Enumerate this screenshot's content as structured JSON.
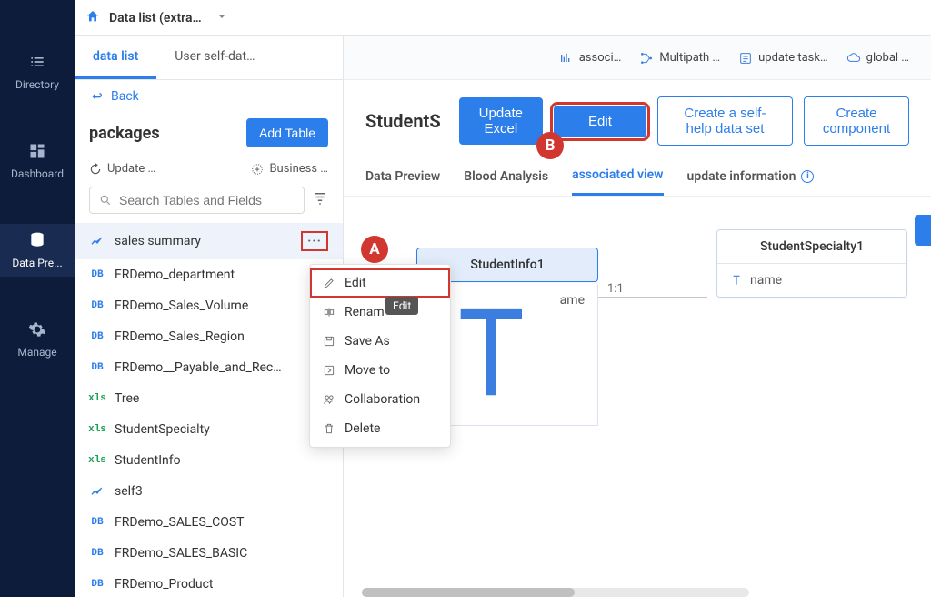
{
  "nav": {
    "items": [
      {
        "label": "Directory"
      },
      {
        "label": "Dashboard"
      },
      {
        "label": "Data Pre..."
      },
      {
        "label": "Manage"
      }
    ]
  },
  "topbar": {
    "title": "Data list (extra…"
  },
  "side": {
    "tabs": {
      "datalist": "data list",
      "selfdata": "User self-dat…"
    },
    "back": "Back",
    "packages_heading": "packages",
    "add_table": "Add Table",
    "update": "Update …",
    "business": "Business …",
    "search_placeholder": "Search Tables and Fields",
    "items": [
      {
        "icon": "chart",
        "label": "sales summary",
        "more": true
      },
      {
        "icon": "db",
        "label": "FRDemo_department"
      },
      {
        "icon": "db",
        "label": "FRDemo_Sales_Volume"
      },
      {
        "icon": "db",
        "label": "FRDemo_Sales_Region"
      },
      {
        "icon": "db",
        "label": "FRDemo__Payable_and_Rec…"
      },
      {
        "icon": "xls",
        "label": "Tree"
      },
      {
        "icon": "xls",
        "label": "StudentSpecialty"
      },
      {
        "icon": "xls",
        "label": "StudentInfo"
      },
      {
        "icon": "chart",
        "label": "self3"
      },
      {
        "icon": "db",
        "label": "FRDemo_SALES_COST"
      },
      {
        "icon": "db",
        "label": "FRDemo_SALES_BASIC"
      },
      {
        "icon": "db",
        "label": "FRDemo_Product"
      }
    ]
  },
  "ctx": {
    "edit": "Edit",
    "rename": "Renam",
    "saveas": "Save As",
    "moveto": "Move to",
    "collab": "Collaboration",
    "delete": "Delete",
    "tooltip": "Edit"
  },
  "badge": {
    "a": "A",
    "b": "B"
  },
  "toolbar": {
    "associ": "associ…",
    "multipath": "Multipath …",
    "updatetask": "update task…",
    "global": "global …"
  },
  "main": {
    "title": "StudentS",
    "update_excel": "Update Excel",
    "edit": "Edit",
    "create_self": "Create a self-help data set",
    "create_comp": "Create component",
    "subtabs": {
      "preview": "Data Preview",
      "blood": "Blood Analysis",
      "assoc": "associated view",
      "update": "update information"
    },
    "diagram": {
      "node1_title": "StudentInfo1",
      "node1_field": "ame",
      "relation": "1:1",
      "node2_title": "StudentSpecialty1",
      "node2_field": "name"
    }
  }
}
